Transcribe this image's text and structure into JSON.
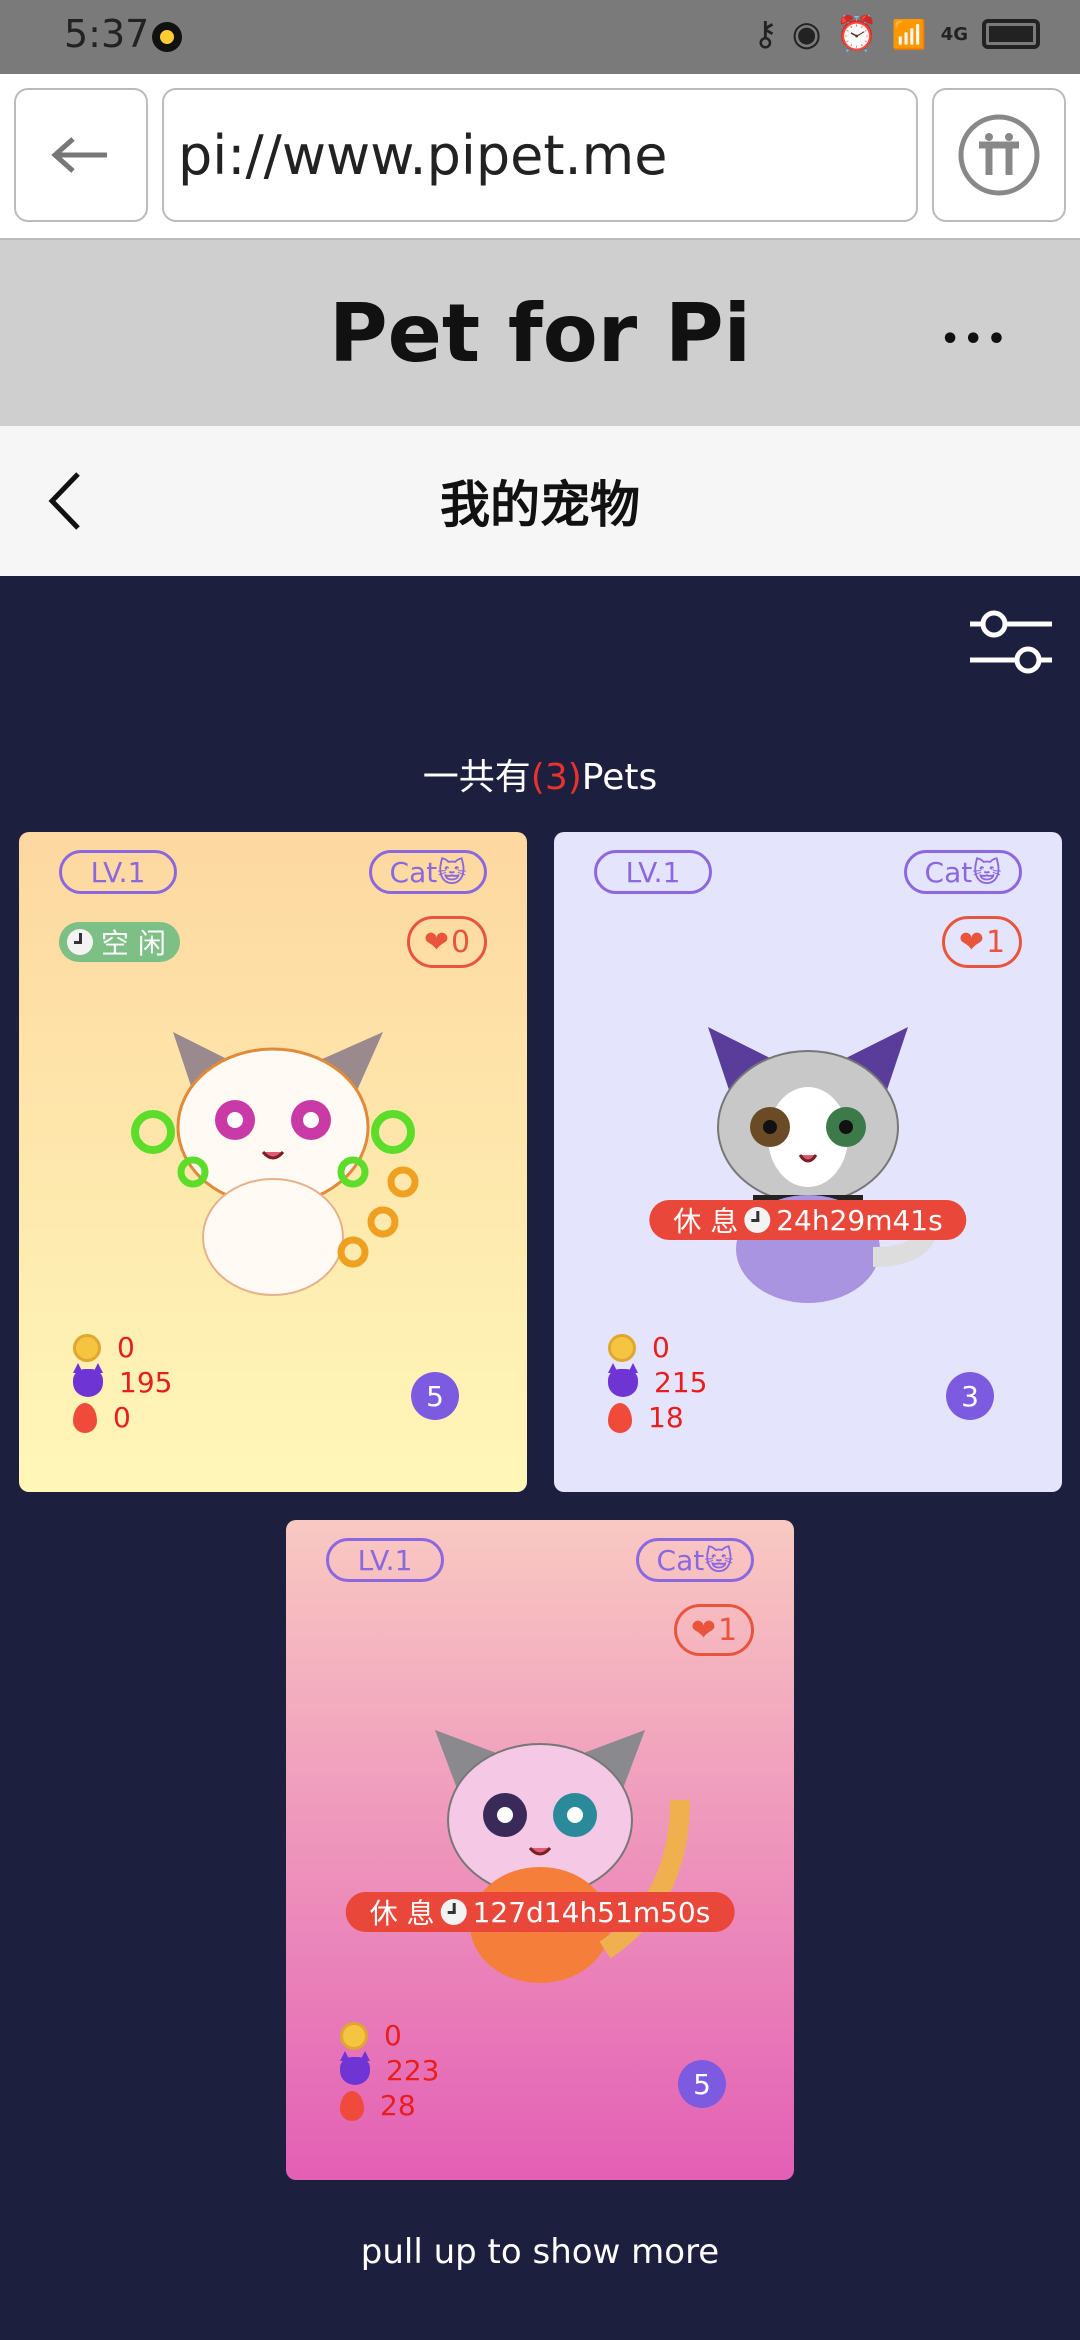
{
  "status_bar": {
    "time": "5:37",
    "network": "4G"
  },
  "browser": {
    "url": "pi://www.pipet.me"
  },
  "app": {
    "title": "Pet for Pi",
    "more": "•••"
  },
  "page": {
    "title": "我的宠物"
  },
  "summary": {
    "prefix": "一共有",
    "count": "(3)",
    "suffix": "Pets"
  },
  "pets": [
    {
      "level": "LV.1",
      "type": "Cat😺",
      "likes": "0",
      "status": "空 闲",
      "rest_text": "",
      "coins": "0",
      "power": "195",
      "energy": "0",
      "badge": "5"
    },
    {
      "level": "LV.1",
      "type": "Cat😺",
      "likes": "1",
      "status": "",
      "rest_text": "休 息",
      "rest_time": "24h29m41s",
      "coins": "0",
      "power": "215",
      "energy": "18",
      "badge": "3"
    },
    {
      "level": "LV.1",
      "type": "Cat😺",
      "likes": "1",
      "status": "",
      "rest_text": "休 息",
      "rest_time": "127d14h51m50s",
      "coins": "0",
      "power": "223",
      "energy": "28",
      "badge": "5"
    }
  ],
  "footer": {
    "pull_more": "pull up to show more"
  }
}
